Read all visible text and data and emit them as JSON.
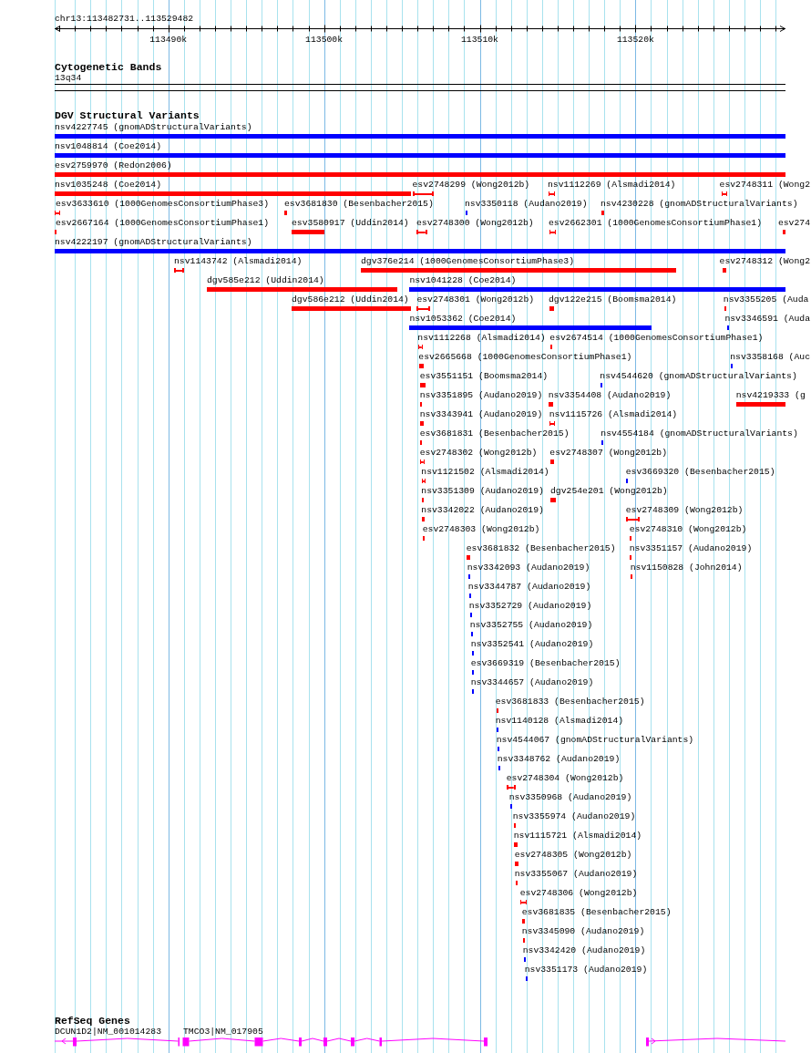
{
  "ruler": {
    "region": "chr13:113482731..113529482",
    "ticks": [
      "113490k",
      "113500k",
      "113510k",
      "113520k"
    ]
  },
  "tracks": [
    {
      "kind": "bands",
      "title": "Cytogenetic Bands",
      "features": [
        {
          "label": "13q34"
        }
      ]
    },
    {
      "kind": "variants",
      "title": "DGV Structural Variants",
      "features": [
        {
          "label": "nsv4227745 (gnomADStructuralVariants)",
          "color": "#0000ff",
          "kind": "bar"
        },
        {
          "label": "nsv1048814 (Coe2014)",
          "color": "#0000ff",
          "kind": "bar"
        },
        {
          "label": "esv2759970 (Redon2006)",
          "color": "#ff0000",
          "kind": "bar"
        },
        {
          "label": "nsv1035248 (Coe2014)",
          "color": "#ff0000",
          "kind": "bar"
        },
        {
          "label": "esv2748299 (Wong2012b)",
          "color": "#ff0000",
          "kind": "bracket"
        },
        {
          "label": "nsv1112269 (Alsmadi2014)",
          "color": "#ff0000",
          "kind": "bracket"
        },
        {
          "label": "esv2748311 (Wong2",
          "color": "#ff0000",
          "kind": "bracket"
        },
        {
          "label": "esv3633610 (1000GenomesConsortiumPhase3)",
          "color": "#ff0000",
          "kind": "bracket"
        },
        {
          "label": "esv3681830 (Besenbacher2015)",
          "color": "#ff0000",
          "kind": "bar"
        },
        {
          "label": "nsv3350118 (Audano2019)",
          "color": "#0000ff",
          "kind": "bar"
        },
        {
          "label": "nsv4230228 (gnomADStructuralVariants)",
          "color": "#ff0000",
          "kind": "bar"
        },
        {
          "label": "esv2667164 (1000GenomesConsortiumPhase1)",
          "color": "#ff0000",
          "kind": "bar"
        },
        {
          "label": "esv3580917 (Uddin2014)",
          "color": "#ff0000",
          "kind": "bar"
        },
        {
          "label": "esv2748300 (Wong2012b)",
          "color": "#ff0000",
          "kind": "bracket"
        },
        {
          "label": "esv2662301 (1000GenomesConsortiumPhase1)",
          "color": "#ff0000",
          "kind": "bracket"
        },
        {
          "label": "esv274",
          "color": "#ff0000",
          "kind": "bar"
        },
        {
          "label": "nsv4222197 (gnomADStructuralVariants)",
          "color": "#0000ff",
          "kind": "bar"
        },
        {
          "label": "nsv1143742 (Alsmadi2014)",
          "color": "#ff0000",
          "kind": "bracket"
        },
        {
          "label": "dgv376e214 (1000GenomesConsortiumPhase3)",
          "color": "#ff0000",
          "kind": "bar"
        },
        {
          "label": "esv2748312 (Wong2",
          "color": "#ff0000",
          "kind": "bar"
        },
        {
          "label": "dgv585e212 (Uddin2014)",
          "color": "#ff0000",
          "kind": "bar"
        },
        {
          "label": "nsv1041228 (Coe2014)",
          "color": "#0000ff",
          "kind": "bar"
        },
        {
          "label": "dgv586e212 (Uddin2014)",
          "color": "#ff0000",
          "kind": "bar"
        },
        {
          "label": "esv2748301 (Wong2012b)",
          "color": "#ff0000",
          "kind": "bracket"
        },
        {
          "label": "dgv122e215 (Boomsma2014)",
          "color": "#ff0000",
          "kind": "bar"
        },
        {
          "label": "nsv3355205 (Auda",
          "color": "#ff0000",
          "kind": "bar"
        },
        {
          "label": "nsv1053362 (Coe2014)",
          "color": "#0000ff",
          "kind": "bar"
        },
        {
          "label": "nsv3346591 (Auda",
          "color": "#0000ff",
          "kind": "bar"
        },
        {
          "label": "nsv1112268 (Alsmadi2014)",
          "color": "#ff0000",
          "kind": "bracket"
        },
        {
          "label": "esv2674514 (1000GenomesConsortiumPhase1)",
          "color": "#ff0000",
          "kind": "bar"
        },
        {
          "label": "esv2665668 (1000GenomesConsortiumPhase1)",
          "color": "#ff0000",
          "kind": "bar"
        },
        {
          "label": "nsv3358168 (Auc",
          "color": "#0000ff",
          "kind": "bar"
        },
        {
          "label": "esv3551151 (Boomsma2014)",
          "color": "#ff0000",
          "kind": "bar"
        },
        {
          "label": "nsv4544620 (gnomADStructuralVariants)",
          "color": "#0000ff",
          "kind": "bar"
        },
        {
          "label": "nsv3351895 (Audano2019)",
          "color": "#ff0000",
          "kind": "bar"
        },
        {
          "label": "nsv3354408 (Audano2019)",
          "color": "#ff0000",
          "kind": "bar"
        },
        {
          "label": "nsv4219333 (g",
          "color": "#ff0000",
          "kind": "bar"
        },
        {
          "label": "nsv3343941 (Audano2019)",
          "color": "#ff0000",
          "kind": "bar"
        },
        {
          "label": "nsv1115726 (Alsmadi2014)",
          "color": "#ff0000",
          "kind": "bracket"
        },
        {
          "label": "esv3681831 (Besenbacher2015)",
          "color": "#ff0000",
          "kind": "bar"
        },
        {
          "label": "nsv4554184 (gnomADStructuralVariants)",
          "color": "#0000ff",
          "kind": "bar"
        },
        {
          "label": "esv2748302 (Wong2012b)",
          "color": "#ff0000",
          "kind": "bracket"
        },
        {
          "label": "esv2748307 (Wong2012b)",
          "color": "#ff0000",
          "kind": "bar"
        },
        {
          "label": "nsv1121502 (Alsmadi2014)",
          "color": "#ff0000",
          "kind": "bracket"
        },
        {
          "label": "esv3669320 (Besenbacher2015)",
          "color": "#0000ff",
          "kind": "bar"
        },
        {
          "label": "nsv3351309 (Audano2019)",
          "color": "#ff0000",
          "kind": "bar"
        },
        {
          "label": "dgv254e201 (Wong2012b)",
          "color": "#ff0000",
          "kind": "bar"
        },
        {
          "label": "nsv3342022 (Audano2019)",
          "color": "#ff0000",
          "kind": "bar"
        },
        {
          "label": "esv2748309 (Wong2012b)",
          "color": "#ff0000",
          "kind": "bracket"
        },
        {
          "label": "esv2748303 (Wong2012b)",
          "color": "#ff0000",
          "kind": "bar"
        },
        {
          "label": "esv2748310 (Wong2012b)",
          "color": "#ff0000",
          "kind": "bar"
        },
        {
          "label": "esv3681832 (Besenbacher2015)",
          "color": "#ff0000",
          "kind": "bar"
        },
        {
          "label": "nsv3351157 (Audano2019)",
          "color": "#ff0000",
          "kind": "bar"
        },
        {
          "label": "nsv3342093 (Audano2019)",
          "color": "#0000ff",
          "kind": "bar"
        },
        {
          "label": "nsv1150828 (John2014)",
          "color": "#ff0000",
          "kind": "bar"
        },
        {
          "label": "nsv3344787 (Audano2019)",
          "color": "#0000ff",
          "kind": "bar"
        },
        {
          "label": "nsv3352729 (Audano2019)",
          "color": "#0000ff",
          "kind": "bar"
        },
        {
          "label": "nsv3352755 (Audano2019)",
          "color": "#0000ff",
          "kind": "bar"
        },
        {
          "label": "nsv3352541 (Audano2019)",
          "color": "#0000ff",
          "kind": "bar"
        },
        {
          "label": "esv3669319 (Besenbacher2015)",
          "color": "#0000ff",
          "kind": "bar"
        },
        {
          "label": "nsv3344657 (Audano2019)",
          "color": "#0000ff",
          "kind": "bar"
        },
        {
          "label": "esv3681833 (Besenbacher2015)",
          "color": "#ff0000",
          "kind": "bar"
        },
        {
          "label": "nsv1140128 (Alsmadi2014)",
          "color": "#0000ff",
          "kind": "bar"
        },
        {
          "label": "nsv4544067 (gnomADStructuralVariants)",
          "color": "#0000ff",
          "kind": "bar"
        },
        {
          "label": "nsv3348762 (Audano2019)",
          "color": "#0000ff",
          "kind": "bar"
        },
        {
          "label": "esv2748304 (Wong2012b)",
          "color": "#ff0000",
          "kind": "bracket"
        },
        {
          "label": "nsv3350968 (Audano2019)",
          "color": "#0000ff",
          "kind": "bar"
        },
        {
          "label": "nsv3355974 (Audano2019)",
          "color": "#ff0000",
          "kind": "bar"
        },
        {
          "label": "nsv1115721 (Alsmadi2014)",
          "color": "#ff0000",
          "kind": "bar"
        },
        {
          "label": "esv2748305 (Wong2012b)",
          "color": "#ff0000",
          "kind": "bar"
        },
        {
          "label": "nsv3355067 (Audano2019)",
          "color": "#ff0000",
          "kind": "bar"
        },
        {
          "label": "esv2748306 (Wong2012b)",
          "color": "#ff0000",
          "kind": "bracket"
        },
        {
          "label": "esv3681835 (Besenbacher2015)",
          "color": "#ff0000",
          "kind": "bar"
        },
        {
          "label": "nsv3345090 (Audano2019)",
          "color": "#ff0000",
          "kind": "bar"
        },
        {
          "label": "nsv3342420 (Audano2019)",
          "color": "#0000ff",
          "kind": "bar"
        },
        {
          "label": "nsv3351173 (Audano2019)",
          "color": "#0000ff",
          "kind": "bar"
        }
      ]
    },
    {
      "kind": "genes",
      "title": "RefSeq Genes",
      "features": [
        {
          "label": "DCUN1D2|NM_001014283"
        },
        {
          "label": "TMCO3|NM_017905"
        }
      ]
    }
  ]
}
